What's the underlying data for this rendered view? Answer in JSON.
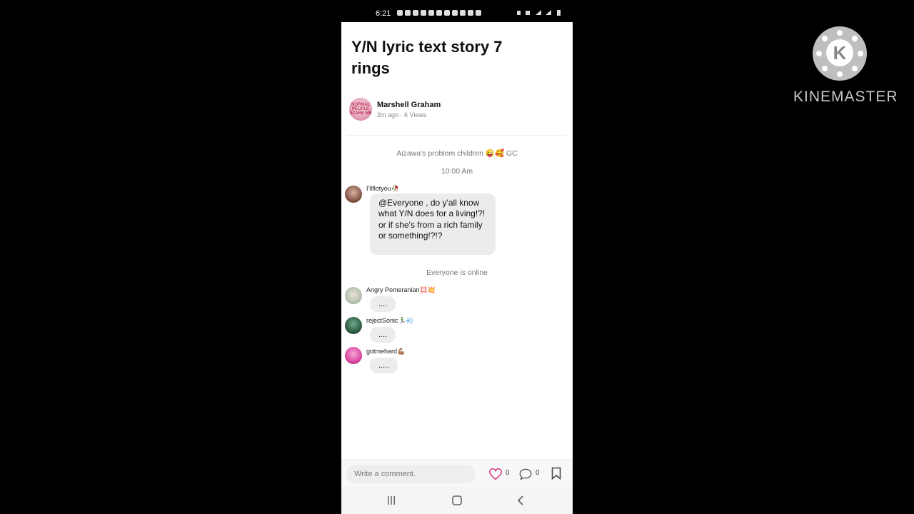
{
  "status_bar": {
    "time": "6:21"
  },
  "post": {
    "title": "Y/N lyric text story 7 rings",
    "author": {
      "name": "Marshell Graham",
      "meta": "2m ago · 6 Views",
      "avatar_text": "NORMAL PEOPLE SCARE ME"
    }
  },
  "chat": {
    "group_name": "Aizawa's problem children 😜🥰 GC",
    "timestamp": "10:00 Am",
    "first_message": {
      "sender": "I'llflotyou🥀",
      "text": "@Everyone , do y'all know what Y/N does for a living!?! or if she's from a rich family or something!?!?"
    },
    "online_notice": "Everyone is online",
    "messages": [
      {
        "sender": "Angry Pomeranian💢💥",
        "text": "...."
      },
      {
        "sender": "rejectSonic🏃‍♂️💨",
        "text": "...."
      },
      {
        "sender": "gotmehard💪🏽",
        "text": "....."
      }
    ]
  },
  "comment_bar": {
    "placeholder": "Write a comment.",
    "likes": "0",
    "comments": "0"
  },
  "watermark": {
    "text": "KINEMASTER",
    "letter": "K"
  }
}
